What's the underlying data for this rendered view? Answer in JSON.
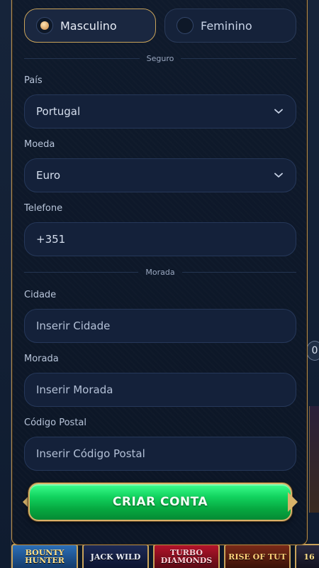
{
  "gender": {
    "options": [
      {
        "label": "Masculino",
        "selected": true
      },
      {
        "label": "Feminino",
        "selected": false
      }
    ]
  },
  "sections": {
    "seguro": "Seguro",
    "morada": "Morada"
  },
  "fields": {
    "pais": {
      "label": "País",
      "value": "Portugal"
    },
    "moeda": {
      "label": "Moeda",
      "value": "Euro"
    },
    "telefone": {
      "label": "Telefone",
      "value": "+351"
    },
    "cidade": {
      "label": "Cidade",
      "placeholder": "Inserir Cidade"
    },
    "morada": {
      "label": "Morada",
      "placeholder": "Inserir Morada"
    },
    "codigo_postal": {
      "label": "Código Postal",
      "placeholder": "Inserir Código Postal"
    }
  },
  "cta": {
    "label": "CRIAR CONTA"
  },
  "background": {
    "side_circle_text": "0",
    "games": [
      "BOUNTY HUNTER",
      "JACK WILD",
      "TURBO DIAMONDS",
      "RISE OF TUT",
      "16"
    ]
  },
  "colors": {
    "accent_gold": "#c9a35a",
    "cta_green": "#12d35f",
    "field_bg": "#14213a",
    "modal_bg": "#0f1a2c"
  }
}
